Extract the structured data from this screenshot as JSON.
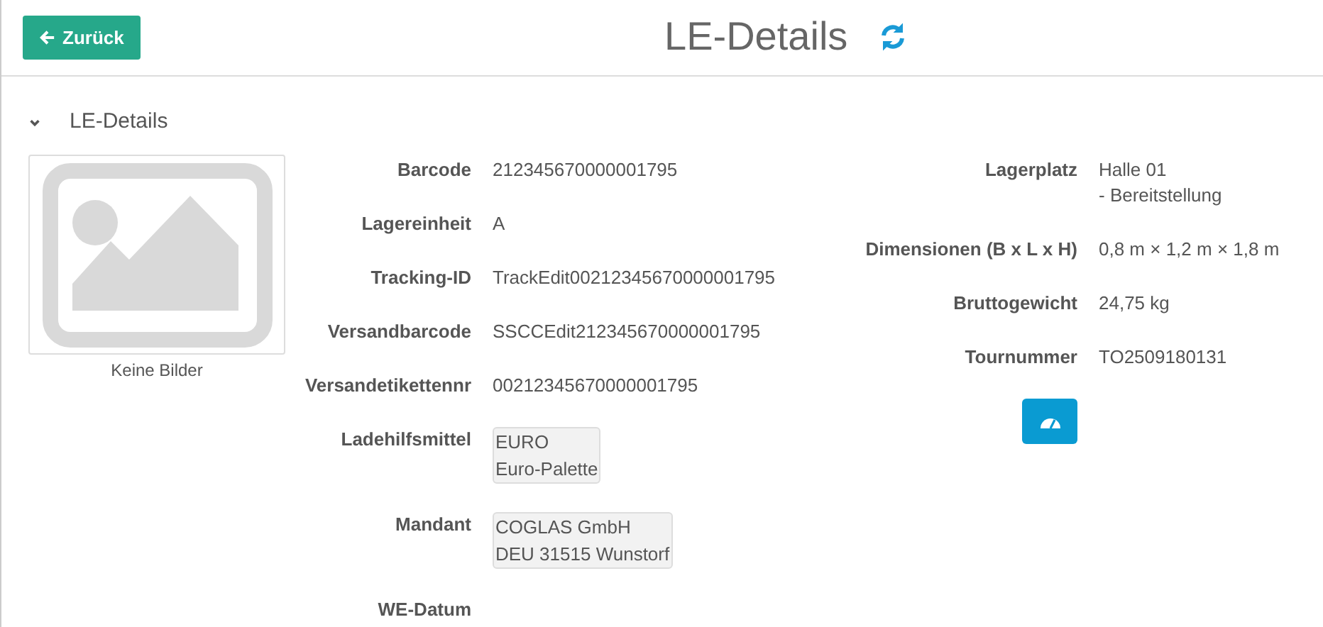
{
  "back_button": {
    "label": "Zurück"
  },
  "page_title": "LE-Details",
  "section": {
    "title": "LE-Details",
    "expanded": true
  },
  "image": {
    "caption": "Keine Bilder"
  },
  "left_fields": [
    {
      "label": "Barcode",
      "kind": "text",
      "lines": [
        "212345670000001795"
      ]
    },
    {
      "label": "Lagereinheit",
      "kind": "text",
      "lines": [
        "A"
      ]
    },
    {
      "label": "Tracking-ID",
      "kind": "text",
      "lines": [
        "TrackEdit00212345670000001795"
      ]
    },
    {
      "label": "Versandbarcode",
      "kind": "text",
      "lines": [
        "SSCCEdit212345670000001795"
      ]
    },
    {
      "label": "Versandetikettennr",
      "kind": "text",
      "lines": [
        "00212345670000001795"
      ]
    },
    {
      "label": "Ladehilfsmittel",
      "kind": "tag",
      "lines": [
        "EURO",
        "Euro-Palette"
      ]
    },
    {
      "label": "Mandant",
      "kind": "tag",
      "lines": [
        "COGLAS GmbH",
        "DEU 31515 Wunstorf"
      ]
    },
    {
      "label": "WE-Datum",
      "kind": "text"
    }
  ],
  "right_fields": [
    {
      "label": "Lagerplatz",
      "kind": "text",
      "lines": [
        "Halle 01",
        "- Bereitstellung"
      ]
    },
    {
      "label": "Dimensionen (B x L x H)",
      "kind": "text",
      "lines": [
        "0,8 m × 1,2 m × 1,8 m"
      ]
    },
    {
      "label": "Bruttogewicht",
      "kind": "text",
      "lines": [
        "24,75 kg"
      ]
    },
    {
      "label": "Tournummer",
      "kind": "text",
      "lines": [
        "TO2509180131"
      ]
    }
  ]
}
